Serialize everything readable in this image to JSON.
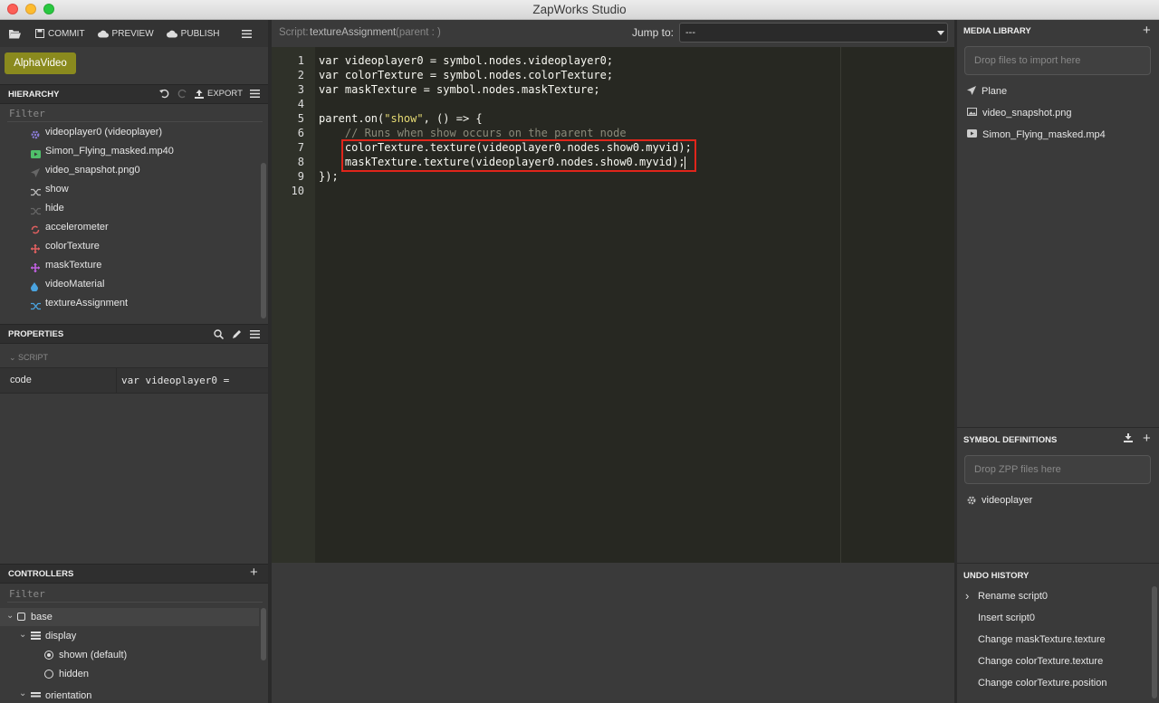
{
  "window": {
    "title": "ZapWorks Studio"
  },
  "toolbar": {
    "commit": "COMMIT",
    "preview": "PREVIEW",
    "publish": "PUBLISH"
  },
  "project_button": "AlphaVideo",
  "hierarchy": {
    "title": "HIERARCHY",
    "export": "EXPORT",
    "filter_placeholder": "Filter",
    "items": [
      {
        "label": "videoplayer0 (videoplayer)",
        "icon": "gear-icon",
        "color": "#8b7cd8"
      },
      {
        "label": "Simon_Flying_masked.mp40",
        "icon": "video-icon",
        "color": "#4fbf6a"
      },
      {
        "label": "video_snapshot.png0",
        "icon": "plane-icon",
        "color": "#666666"
      },
      {
        "label": "show",
        "icon": "shuffle-icon",
        "color": "#bbbbbb"
      },
      {
        "label": "hide",
        "icon": "shuffle-icon",
        "color": "#666666"
      },
      {
        "label": "accelerometer",
        "icon": "sync-icon",
        "color": "#e06060"
      },
      {
        "label": "colorTexture",
        "icon": "move-icon",
        "color": "#e06060"
      },
      {
        "label": "maskTexture",
        "icon": "move-icon",
        "color": "#c060e0"
      },
      {
        "label": "videoMaterial",
        "icon": "drop-icon",
        "color": "#4aa3df"
      },
      {
        "label": "textureAssignment",
        "icon": "shuffle-icon",
        "color": "#4aa3df"
      }
    ]
  },
  "properties": {
    "title": "PROPERTIES",
    "section": "SCRIPT",
    "row": {
      "key": "code",
      "value": "var videoplayer0 ="
    }
  },
  "controllers": {
    "title": "CONTROLLERS",
    "filter_placeholder": "Filter",
    "base": "base",
    "display": "display",
    "shown": "shown (default)",
    "hidden": "hidden",
    "orientation": "orientation"
  },
  "editor": {
    "script_prefix": "Script:",
    "script_name": "textureAssignment",
    "parent_hint": "(parent : )",
    "jump_label": "Jump to:",
    "jump_value": "---",
    "line_numbers": [
      "1",
      "2",
      "3",
      "4",
      "5",
      "6",
      "7",
      "8",
      "9",
      "10"
    ]
  },
  "media_library": {
    "title": "MEDIA LIBRARY",
    "drop_text": "Drop files to import here",
    "items": [
      {
        "label": "Plane",
        "icon": "plane-icon"
      },
      {
        "label": "video_snapshot.png",
        "icon": "image-icon"
      },
      {
        "label": "Simon_Flying_masked.mp4",
        "icon": "video-icon"
      }
    ]
  },
  "symbol_definitions": {
    "title": "SYMBOL DEFINITIONS",
    "drop_text": "Drop ZPP files here",
    "items": [
      {
        "label": "videoplayer",
        "icon": "gear-icon"
      }
    ]
  },
  "undo_history": {
    "title": "UNDO HISTORY",
    "items": [
      "Rename script0",
      "Insert script0",
      "Change maskTexture.texture",
      "Change colorTexture.texture",
      "Change colorTexture.position"
    ]
  },
  "colors": {
    "accent_button": "#8a8a1e",
    "highlight_box": "#e0251b"
  }
}
